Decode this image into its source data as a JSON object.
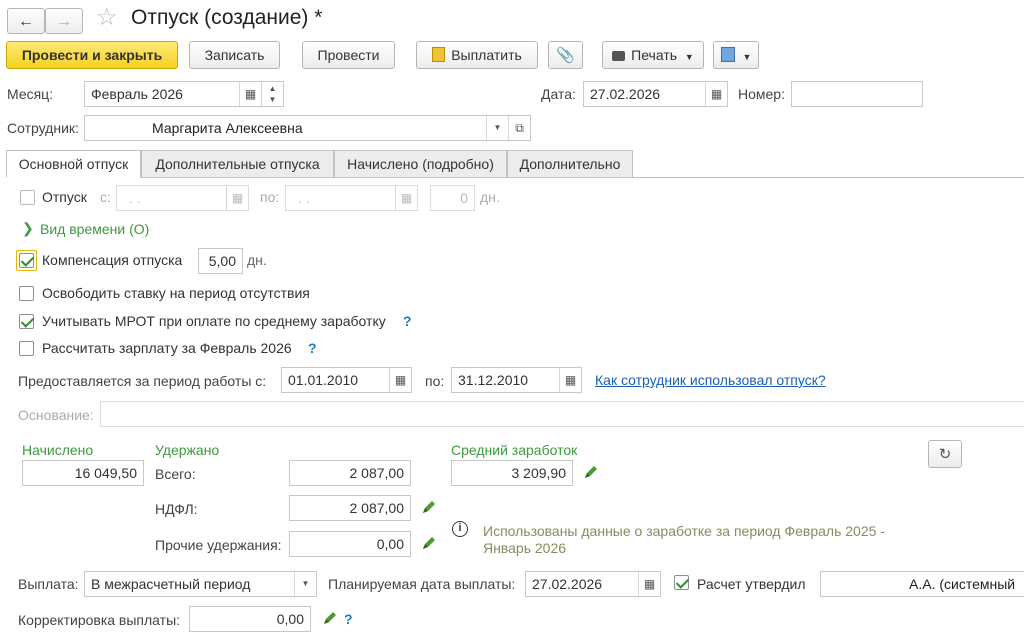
{
  "header": {
    "title": "Отпуск (создание) *"
  },
  "toolbar": {
    "post_close": "Провести и закрыть",
    "save": "Записать",
    "post": "Провести",
    "pay": "Выплатить",
    "print": "Печать"
  },
  "fields": {
    "month_label": "Месяц:",
    "month_value": "Февраль 2026",
    "date_label": "Дата:",
    "date_value": "27.02.2026",
    "number_label": "Номер:",
    "number_value": "",
    "employee_label": "Сотрудник:",
    "employee_value": "Маргарита Алексеевна"
  },
  "tabs": [
    {
      "label": "Основной отпуск",
      "active": true
    },
    {
      "label": "Дополнительные отпуска",
      "active": false
    },
    {
      "label": "Начислено (подробно)",
      "active": false
    },
    {
      "label": "Дополнительно",
      "active": false
    }
  ],
  "vacation": {
    "label": "Отпуск",
    "from_label": "с:",
    "from_value": ". .",
    "to_label": "по:",
    "to_value": ". .",
    "days_value": "0",
    "days_unit": "дн."
  },
  "time_type": {
    "label": "Вид времени (О)"
  },
  "compensation": {
    "label": "Компенсация отпуска",
    "checked": true,
    "value": "5,00",
    "unit": "дн."
  },
  "free_rate": {
    "label": "Освободить ставку на период отсутствия",
    "checked": false
  },
  "mrot": {
    "label": "Учитывать МРОТ при оплате по среднему заработку",
    "checked": true,
    "help": "?"
  },
  "salary": {
    "label": "Рассчитать зарплату за Февраль 2026",
    "checked": false,
    "help": "?"
  },
  "period": {
    "label": "Предоставляется за период работы с:",
    "from_value": "01.01.2010",
    "to_label": "по:",
    "to_value": "31.12.2010",
    "link": "Как сотрудник использовал отпуск?"
  },
  "basis": {
    "label": "Основание:",
    "value": ""
  },
  "totals": {
    "accrued_label": "Начислено",
    "accrued_value": "16 049,50",
    "withheld_label": "Удержано",
    "total_label": "Всего:",
    "total_value": "2 087,00",
    "ndfl_label": "НДФЛ:",
    "ndfl_value": "2 087,00",
    "other_label": "Прочие удержания:",
    "other_value": "0,00",
    "avg_label": "Средний заработок",
    "avg_value": "3 209,90",
    "info_line1": "Использованы данные о заработке за период Февраль 2025 -",
    "info_line2": "Январь 2026"
  },
  "payment": {
    "label": "Выплата:",
    "value": "В межрасчетный период",
    "plan_label": "Планируемая дата выплаты:",
    "plan_value": "27.02.2026",
    "approved_label": "Расчет утвердил",
    "approved_checked": true,
    "approver_value": "А.А. (системный",
    "correction_label": "Корректировка выплаты:",
    "correction_value": "0,00",
    "help": "?"
  }
}
